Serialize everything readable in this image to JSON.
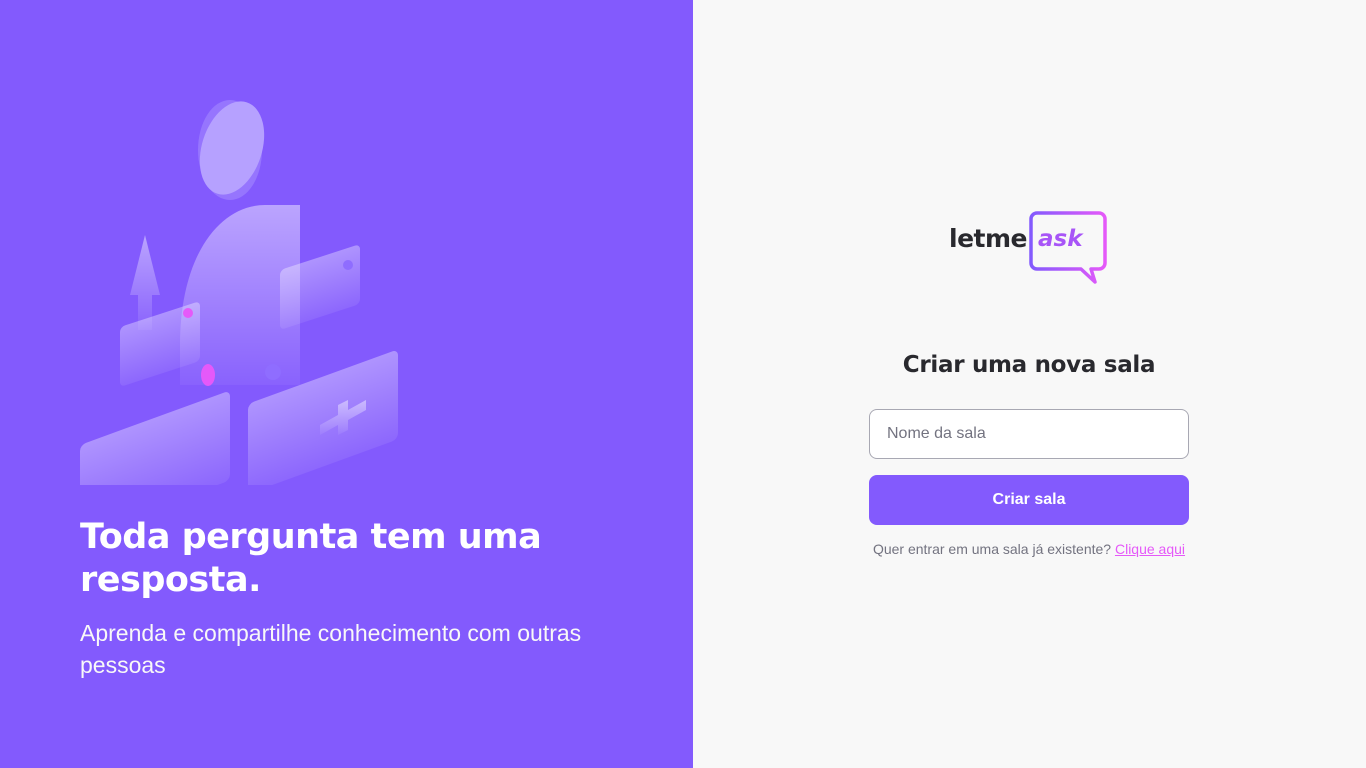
{
  "aside": {
    "title": "Toda pergunta tem uma resposta.",
    "subtitle": "Aprenda e compartilhe conhecimento com outras pessoas",
    "illustration": "people-chat-illustration"
  },
  "logo": {
    "word": "letme",
    "accent": "ask"
  },
  "form": {
    "heading": "Criar uma nova sala",
    "room_name_placeholder": "Nome da sala",
    "room_name_value": "",
    "submit_label": "Criar sala",
    "join_prompt": "Quer entrar em uma sala já existente?",
    "join_link": "Clique aqui"
  },
  "colors": {
    "primary": "#835afd",
    "accent_pink": "#e559f9",
    "background": "#f8f8f8",
    "text_dark": "#29292e",
    "text_muted": "#737380"
  }
}
